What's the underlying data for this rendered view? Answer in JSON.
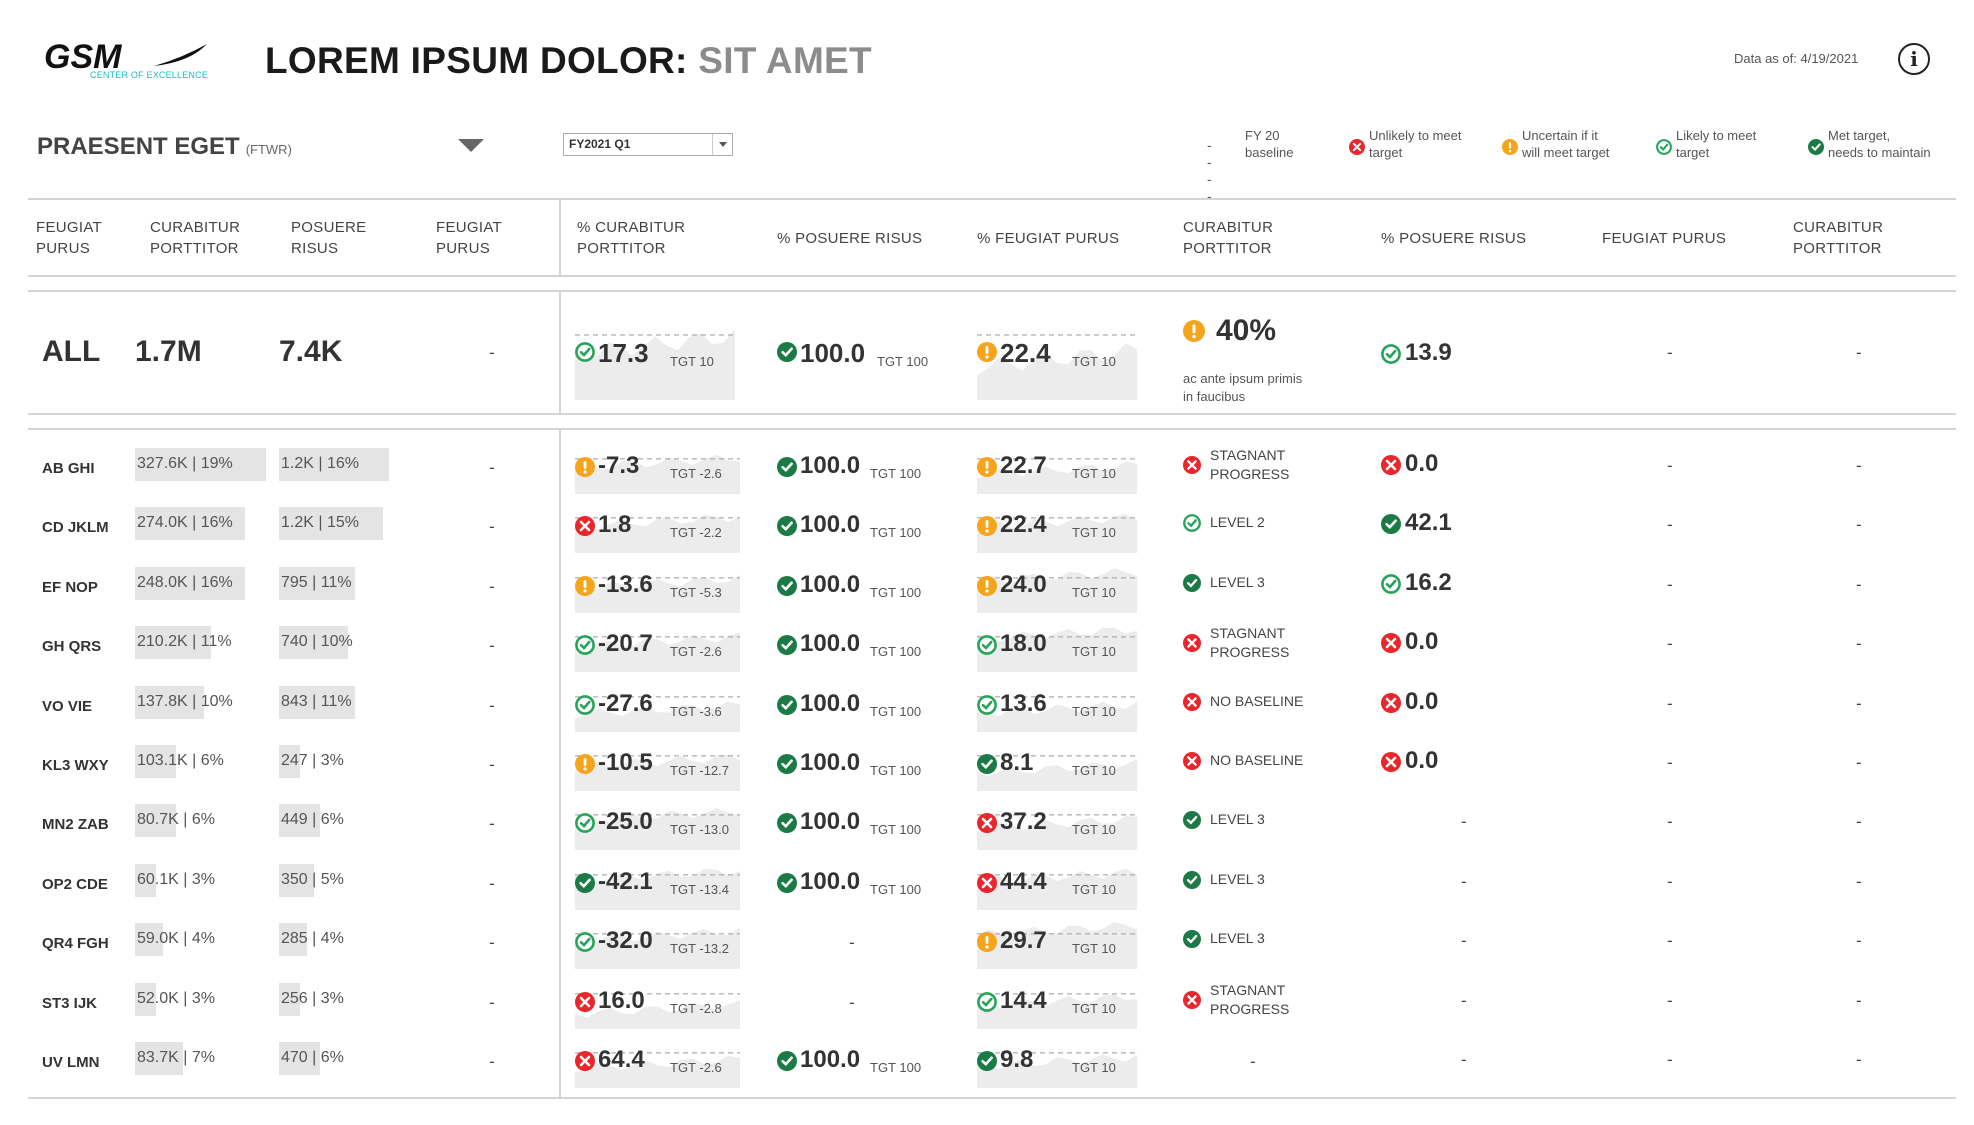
{
  "header": {
    "logo_text": "GSM",
    "logo_sub": "CENTER OF EXCELLENCE",
    "title_main": "LOREM IPSUM DOLOR:",
    "title_sub": " SIT AMET",
    "as_of": "Data as of: 4/19/2021",
    "info_icon": "info-icon"
  },
  "filter": {
    "title": "PRAESENT EGET",
    "qualifier": "(FTWR)",
    "period": "FY2021 Q1"
  },
  "legend": {
    "baseline_symbol": "----",
    "baseline_line1": "FY 20",
    "baseline_line2": "baseline",
    "unlikely_line1": "Unlikely to meet",
    "unlikely_line2": "target",
    "uncertain_line1": "Uncertain if it",
    "uncertain_line2": "will meet target",
    "likely_line1": "Likely to meet",
    "likely_line2": "target",
    "met_line1": "Met target,",
    "met_line2": "needs to maintain"
  },
  "colors": {
    "red": "#e8262b",
    "orange": "#f5a41b",
    "green_ring": "#27a35a",
    "green_dark": "#1b7a45",
    "bar": "#e4e4e4"
  },
  "columns": {
    "c1_l1": "FEUGIAT",
    "c1_l2": "PURUS",
    "c2_l1": "CURABITUR",
    "c2_l2": "PORTTITOR",
    "c3_l1": "POSUERE",
    "c3_l2": "RISUS",
    "c4_l1": "FEUGIAT",
    "c4_l2": "PURUS",
    "c5_l1": "% CURABITUR",
    "c5_l2": "PORTTITOR",
    "c6": "% POSUERE RISUS",
    "c7": "% FEUGIAT PURUS",
    "c8_l1": "CURABITUR",
    "c8_l2": "PORTTITOR",
    "c9": "% POSUERE RISUS",
    "c10": "FEUGIAT PURUS",
    "c11_l1": "CURABITUR",
    "c11_l2": "PORTTITOR"
  },
  "total": {
    "label": "ALL",
    "c2": "1.7M",
    "c3": "7.4K",
    "c4": "-",
    "k1": {
      "status": "likely",
      "value": "17.3",
      "tgt": "TGT 10"
    },
    "k2": {
      "status": "met",
      "value": "100.0",
      "tgt": "TGT 100"
    },
    "k3": {
      "status": "uncertain",
      "value": "22.4",
      "tgt": "TGT 10"
    },
    "status": {
      "status": "uncertain",
      "big": "40%",
      "note_l1": "ac ante ipsum primis",
      "note_l2": "in faucibus"
    },
    "pct": {
      "status": "likely",
      "value": "13.9"
    },
    "c10": "-",
    "c11": "-"
  },
  "rows": [
    {
      "label": "AB GHI",
      "c2": "327.6K | 19%",
      "c2_frac": 0.19,
      "c3": "1.2K | 16%",
      "c3_frac": 0.16,
      "c4": "-",
      "k1": {
        "status": "uncertain",
        "value": "-7.3",
        "tgt": "TGT -2.6"
      },
      "k2": {
        "status": "met",
        "value": "100.0",
        "tgt": "TGT 100"
      },
      "k3": {
        "status": "uncertain",
        "value": "22.7",
        "tgt": "TGT 10"
      },
      "st": {
        "status": "unlikely",
        "l1": "STAGNANT",
        "l2": "PROGRESS"
      },
      "pct": {
        "status": "unlikely",
        "value": "0.0"
      },
      "c10": "-",
      "c11": "-"
    },
    {
      "label": "CD JKLM",
      "c2": "274.0K | 16%",
      "c2_frac": 0.16,
      "c3": "1.2K | 15%",
      "c3_frac": 0.15,
      "c4": "-",
      "k1": {
        "status": "unlikely",
        "value": "1.8",
        "tgt": "TGT -2.2"
      },
      "k2": {
        "status": "met",
        "value": "100.0",
        "tgt": "TGT 100"
      },
      "k3": {
        "status": "uncertain",
        "value": "22.4",
        "tgt": "TGT 10"
      },
      "st": {
        "status": "likely",
        "l1": "LEVEL 2",
        "l2": ""
      },
      "pct": {
        "status": "met",
        "value": "42.1"
      },
      "c10": "-",
      "c11": "-"
    },
    {
      "label": "EF NOP",
      "c2": "248.0K | 16%",
      "c2_frac": 0.16,
      "c3": "795 | 11%",
      "c3_frac": 0.11,
      "c4": "-",
      "k1": {
        "status": "uncertain",
        "value": "-13.6",
        "tgt": "TGT -5.3"
      },
      "k2": {
        "status": "met",
        "value": "100.0",
        "tgt": "TGT 100"
      },
      "k3": {
        "status": "uncertain",
        "value": "24.0",
        "tgt": "TGT 10"
      },
      "st": {
        "status": "met",
        "l1": "LEVEL 3",
        "l2": ""
      },
      "pct": {
        "status": "likely",
        "value": "16.2"
      },
      "c10": "-",
      "c11": "-"
    },
    {
      "label": "GH QRS",
      "c2": "210.2K | 11%",
      "c2_frac": 0.11,
      "c3": "740 | 10%",
      "c3_frac": 0.1,
      "c4": "-",
      "k1": {
        "status": "likely",
        "value": "-20.7",
        "tgt": "TGT -2.6"
      },
      "k2": {
        "status": "met",
        "value": "100.0",
        "tgt": "TGT 100"
      },
      "k3": {
        "status": "likely",
        "value": "18.0",
        "tgt": "TGT 10"
      },
      "st": {
        "status": "unlikely",
        "l1": "STAGNANT",
        "l2": "PROGRESS"
      },
      "pct": {
        "status": "unlikely",
        "value": "0.0"
      },
      "c10": "-",
      "c11": "-"
    },
    {
      "label": "VO VIE",
      "c2": "137.8K | 10%",
      "c2_frac": 0.1,
      "c3": "843 | 11%",
      "c3_frac": 0.11,
      "c4": "-",
      "k1": {
        "status": "likely",
        "value": "-27.6",
        "tgt": "TGT -3.6"
      },
      "k2": {
        "status": "met",
        "value": "100.0",
        "tgt": "TGT 100"
      },
      "k3": {
        "status": "likely",
        "value": "13.6",
        "tgt": "TGT 10"
      },
      "st": {
        "status": "unlikely",
        "l1": "NO BASELINE",
        "l2": ""
      },
      "pct": {
        "status": "unlikely",
        "value": "0.0"
      },
      "c10": "-",
      "c11": "-"
    },
    {
      "label": "KL3 WXY",
      "c2": "103.1K | 6%",
      "c2_frac": 0.06,
      "c3": "247 | 3%",
      "c3_frac": 0.03,
      "c4": "-",
      "k1": {
        "status": "uncertain",
        "value": "-10.5",
        "tgt": "TGT -12.7"
      },
      "k2": {
        "status": "met",
        "value": "100.0",
        "tgt": "TGT 100"
      },
      "k3": {
        "status": "met",
        "value": "8.1",
        "tgt": "TGT 10"
      },
      "st": {
        "status": "unlikely",
        "l1": "NO BASELINE",
        "l2": ""
      },
      "pct": {
        "status": "unlikely",
        "value": "0.0"
      },
      "c10": "-",
      "c11": "-"
    },
    {
      "label": "MN2 ZAB",
      "c2": "80.7K | 6%",
      "c2_frac": 0.06,
      "c3": "449 | 6%",
      "c3_frac": 0.06,
      "c4": "-",
      "k1": {
        "status": "likely",
        "value": "-25.0",
        "tgt": "TGT -13.0"
      },
      "k2": {
        "status": "met",
        "value": "100.0",
        "tgt": "TGT 100"
      },
      "k3": {
        "status": "unlikely",
        "value": "37.2",
        "tgt": "TGT 10"
      },
      "st": {
        "status": "met",
        "l1": "LEVEL 3",
        "l2": ""
      },
      "pct": {
        "status": "none",
        "value": "-"
      },
      "c10": "-",
      "c11": "-"
    },
    {
      "label": "OP2 CDE",
      "c2": "60.1K | 3%",
      "c2_frac": 0.03,
      "c3": "350 | 5%",
      "c3_frac": 0.05,
      "c4": "-",
      "k1": {
        "status": "met",
        "value": "-42.1",
        "tgt": "TGT -13.4"
      },
      "k2": {
        "status": "met",
        "value": "100.0",
        "tgt": "TGT 100"
      },
      "k3": {
        "status": "unlikely",
        "value": "44.4",
        "tgt": "TGT 10"
      },
      "st": {
        "status": "met",
        "l1": "LEVEL 3",
        "l2": ""
      },
      "pct": {
        "status": "none",
        "value": "-"
      },
      "c10": "-",
      "c11": "-"
    },
    {
      "label": "QR4 FGH",
      "c2": "59.0K | 4%",
      "c2_frac": 0.04,
      "c3": "285 | 4%",
      "c3_frac": 0.04,
      "c4": "-",
      "k1": {
        "status": "likely",
        "value": "-32.0",
        "tgt": "TGT -13.2"
      },
      "k2": {
        "status": "none",
        "value": "-",
        "tgt": ""
      },
      "k3": {
        "status": "uncertain",
        "value": "29.7",
        "tgt": "TGT 10"
      },
      "st": {
        "status": "met",
        "l1": "LEVEL 3",
        "l2": ""
      },
      "pct": {
        "status": "none",
        "value": "-"
      },
      "c10": "-",
      "c11": "-"
    },
    {
      "label": "ST3 IJK",
      "c2": "52.0K | 3%",
      "c2_frac": 0.03,
      "c3": "256 | 3%",
      "c3_frac": 0.03,
      "c4": "-",
      "k1": {
        "status": "unlikely",
        "value": "16.0",
        "tgt": "TGT -2.8"
      },
      "k2": {
        "status": "none",
        "value": "-",
        "tgt": ""
      },
      "k3": {
        "status": "likely",
        "value": "14.4",
        "tgt": "TGT 10"
      },
      "st": {
        "status": "unlikely",
        "l1": "STAGNANT",
        "l2": "PROGRESS"
      },
      "pct": {
        "status": "none",
        "value": "-"
      },
      "c10": "-",
      "c11": "-"
    },
    {
      "label": "UV LMN",
      "c2": "83.7K | 7%",
      "c2_frac": 0.07,
      "c3": "470 | 6%",
      "c3_frac": 0.06,
      "c4": "-",
      "k1": {
        "status": "unlikely",
        "value": "64.4",
        "tgt": "TGT -2.6"
      },
      "k2": {
        "status": "met",
        "value": "100.0",
        "tgt": "TGT 100"
      },
      "k3": {
        "status": "met",
        "value": "9.8",
        "tgt": "TGT 10"
      },
      "st": {
        "status": "none",
        "l1": "-",
        "l2": ""
      },
      "pct": {
        "status": "none",
        "value": "-"
      },
      "c10": "-",
      "c11": "-"
    }
  ]
}
